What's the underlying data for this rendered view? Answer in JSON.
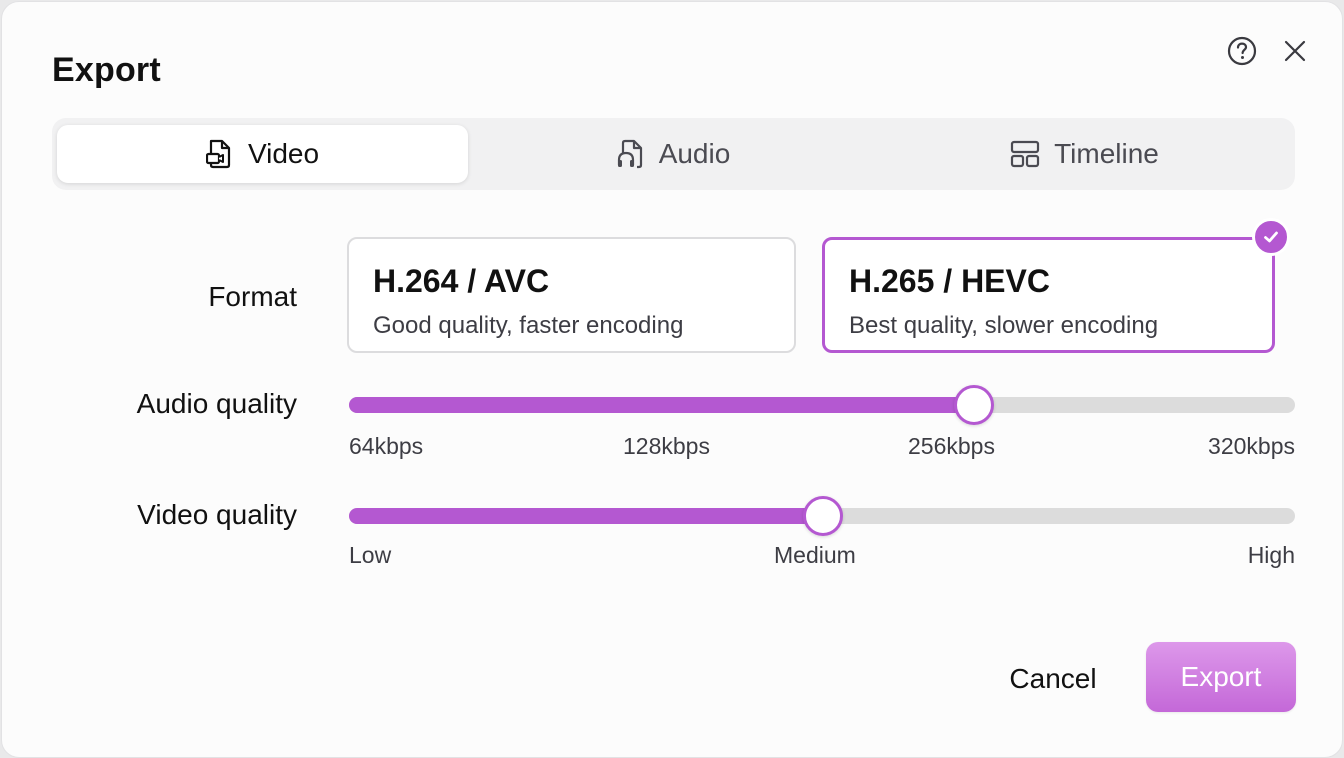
{
  "dialog": {
    "title": "Export",
    "help_icon": "help-circle-icon",
    "close_icon": "close-icon"
  },
  "tabs": [
    {
      "label": "Video",
      "icon": "video-file-icon",
      "active": true
    },
    {
      "label": "Audio",
      "icon": "audio-file-icon",
      "active": false
    },
    {
      "label": "Timeline",
      "icon": "timeline-layout-icon",
      "active": false
    }
  ],
  "format": {
    "label": "Format",
    "options": [
      {
        "title": "H.264 / AVC",
        "description": "Good quality, faster encoding",
        "selected": false
      },
      {
        "title": "H.265 / HEVC",
        "description": "Best quality, slower encoding",
        "selected": true
      }
    ]
  },
  "audio_quality": {
    "label": "Audio quality",
    "ticks": [
      "64kbps",
      "128kbps",
      "256kbps",
      "320kbps"
    ],
    "selected_tick": "256kbps",
    "value_fraction": 0.66
  },
  "video_quality": {
    "label": "Video quality",
    "ticks": [
      "Low",
      "Medium",
      "High"
    ],
    "selected_tick": "Medium",
    "value_fraction": 0.5
  },
  "actions": {
    "cancel_label": "Cancel",
    "export_label": "Export"
  },
  "colors": {
    "accent": "#b458d1",
    "export_button_top": "#dd98ea",
    "export_button_bottom": "#c468d8",
    "track": "#dcdcdc"
  }
}
